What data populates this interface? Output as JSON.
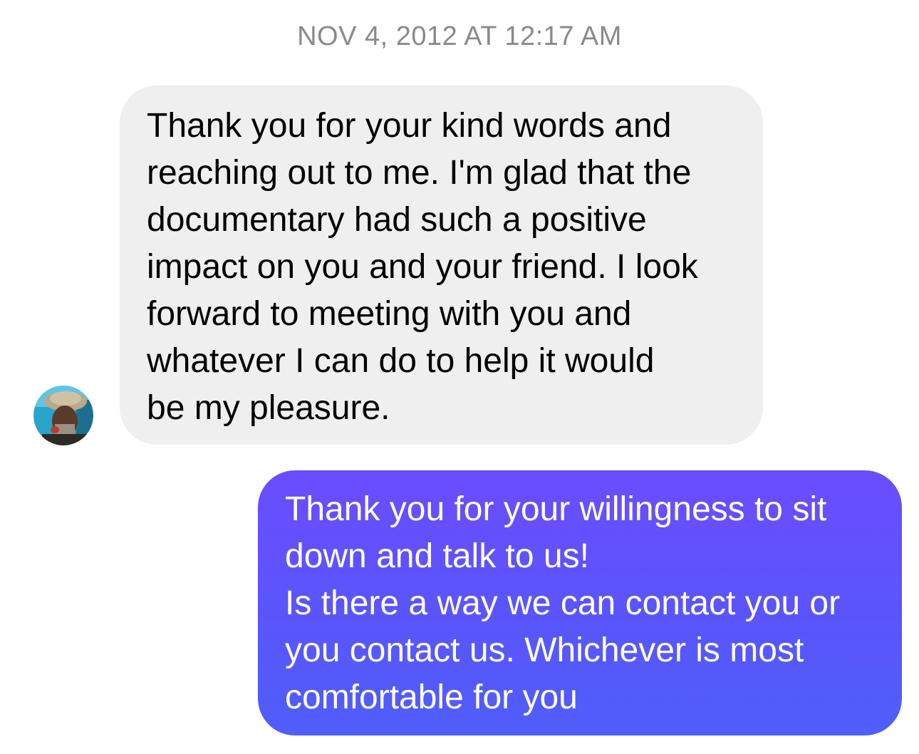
{
  "conversation": {
    "timestamp": "NOV 4, 2012 AT 12:17 AM",
    "messages": [
      {
        "direction": "incoming",
        "text": "Thank you for your kind words and\nreaching out to me. I'm glad that the\ndocumentary had such a positive\nimpact on you and your friend. I look\nforward to meeting with you and\nwhatever I can do to help it would\nbe my pleasure."
      },
      {
        "direction": "outgoing",
        "text": "Thank you for your willingness to sit\ndown and talk to us!\nIs there a way we can contact you or\nyou contact us. Whichever is most\ncomfortable for you"
      }
    ]
  },
  "colors": {
    "incoming_bubble": "#efefef",
    "outgoing_bubble_top": "#6a4dff",
    "outgoing_bubble_bottom": "#4f5efa",
    "timestamp": "#8a8a8e"
  },
  "icons": {
    "avatar": "contact-avatar"
  }
}
